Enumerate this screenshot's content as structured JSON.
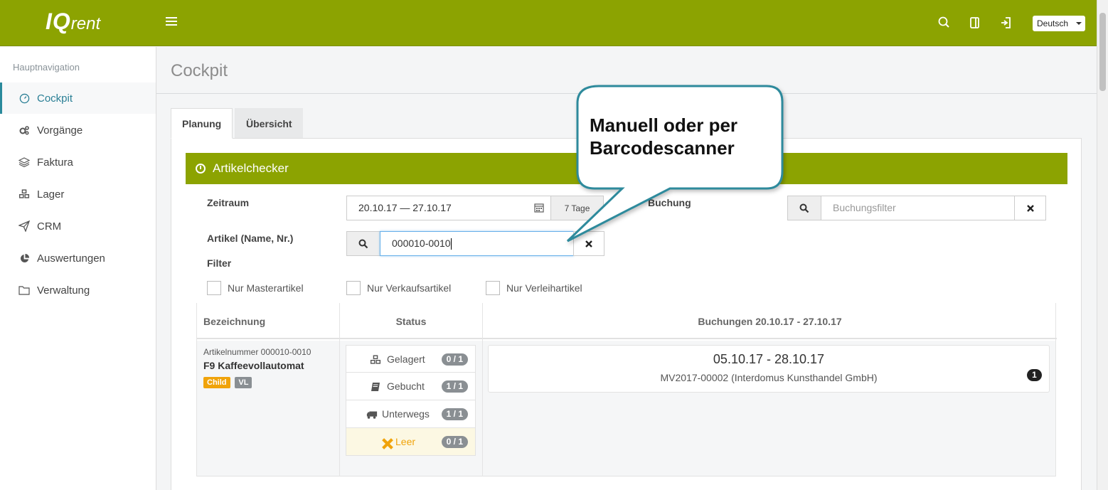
{
  "app": {
    "logo_main": "IQ",
    "logo_sub": "rent",
    "language": "Deutsch"
  },
  "sidebar": {
    "header": "Hauptnavigation",
    "items": [
      {
        "label": "Cockpit",
        "icon": "gauge-icon"
      },
      {
        "label": "Vorgänge",
        "icon": "gears-icon"
      },
      {
        "label": "Faktura",
        "icon": "layers-icon"
      },
      {
        "label": "Lager",
        "icon": "cubes-icon"
      },
      {
        "label": "CRM",
        "icon": "paper-plane-icon"
      },
      {
        "label": "Auswertungen",
        "icon": "pie-chart-icon"
      },
      {
        "label": "Verwaltung",
        "icon": "folder-icon"
      }
    ]
  },
  "page": {
    "title": "Cockpit",
    "tabs": [
      {
        "label": "Planung"
      },
      {
        "label": "Übersicht"
      }
    ]
  },
  "panel": {
    "title": "Artikelchecker",
    "zeitraum_label": "Zeitraum",
    "zeitraum_value": "20.10.17 — 27.10.17",
    "zeitraum_days": "7 Tage",
    "buchung_label": "Buchung",
    "buchung_placeholder": "Buchungsfilter",
    "artikel_label": "Artikel (Name, Nr.)",
    "artikel_value": "000010-0010",
    "filter_label": "Filter",
    "checkboxes": [
      {
        "label": "Nur Masterartikel"
      },
      {
        "label": "Nur Verkaufsartikel"
      },
      {
        "label": "Nur Verleihartikel"
      }
    ]
  },
  "table": {
    "headers": {
      "bezeichnung": "Bezeichnung",
      "status": "Status",
      "buchungen": "Buchungen 20.10.17 - 27.10.17"
    },
    "row": {
      "artikelnummer": "Artikelnummer 000010-0010",
      "name": "F9 Kaffeevollautomat",
      "tags": [
        {
          "label": "Child",
          "color": "#f0a30a"
        },
        {
          "label": "VL",
          "color": "#8a8f93"
        }
      ],
      "status": [
        {
          "label": "Gelagert",
          "badge": "0 / 1",
          "icon": "cubes-icon"
        },
        {
          "label": "Gebucht",
          "badge": "1 / 1",
          "icon": "book-icon"
        },
        {
          "label": "Unterwegs",
          "badge": "1 / 1",
          "icon": "truck-icon"
        },
        {
          "label": "Leer",
          "badge": "0 / 1",
          "icon": "x-icon"
        }
      ],
      "booking": {
        "dates": "05.10.17 - 28.10.17",
        "detail": "MV2017-00002 (Interdomus Kunsthandel GmbH)",
        "count": "1"
      }
    }
  },
  "callout": {
    "line1": "Manuell oder per",
    "line2": "Barcodescanner"
  },
  "colors": {
    "brand": "#8ca301",
    "accent": "#2a7f95",
    "warning": "#f0a30a"
  }
}
